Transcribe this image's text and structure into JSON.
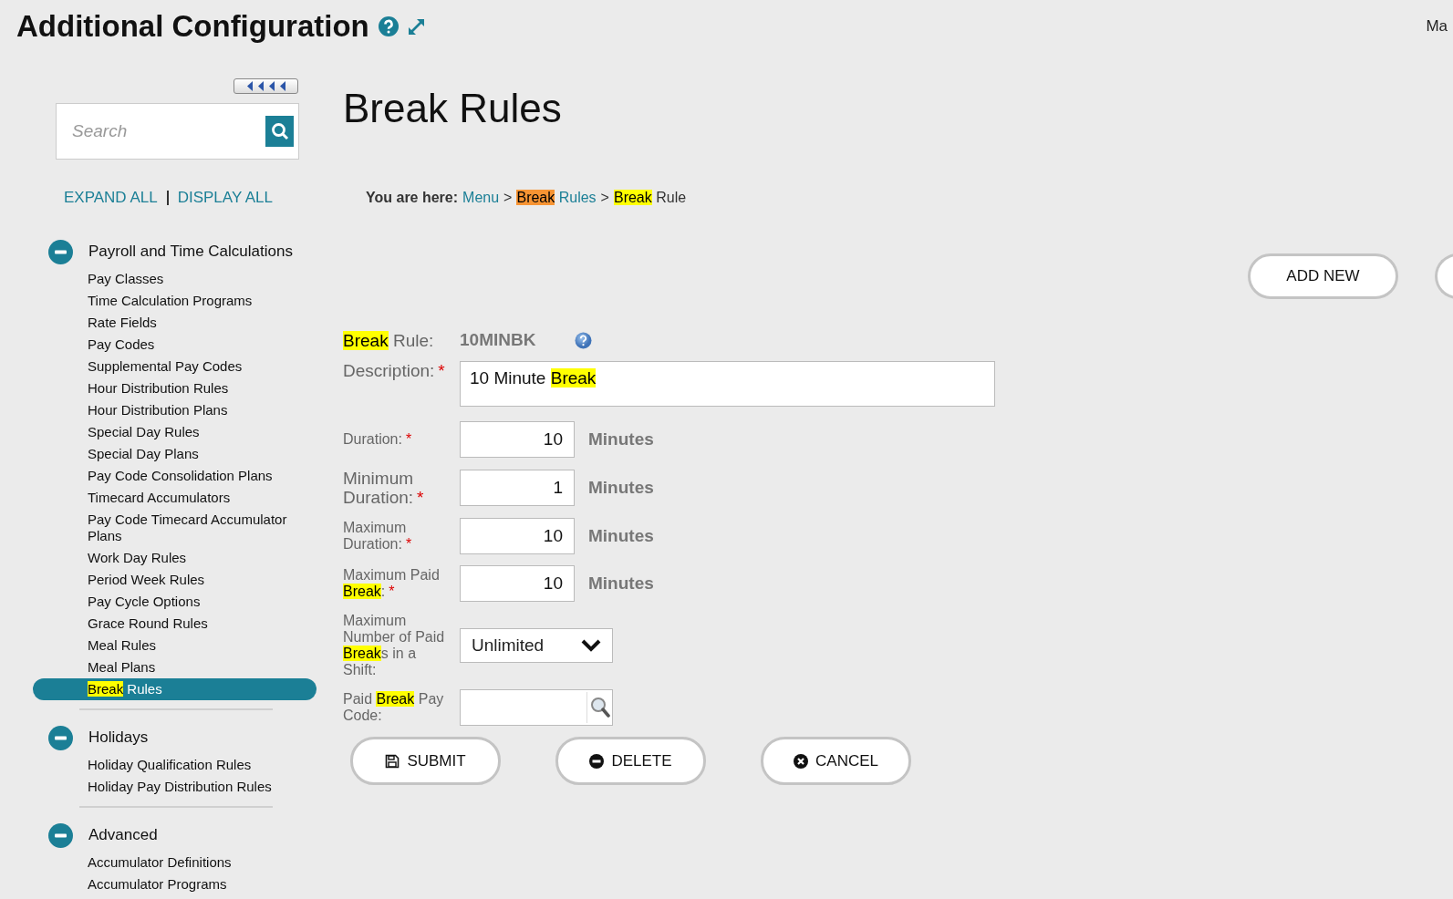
{
  "header": {
    "title": "Additional Configuration",
    "corner_text": "Ma"
  },
  "sidebar": {
    "search": {
      "placeholder": "Search"
    },
    "links": [
      "EXPAND ALL",
      "DISPLAY ALL"
    ],
    "groups": [
      {
        "title": "Payroll and Time Calculations",
        "expanded": true,
        "items": [
          {
            "parts": [
              {
                "text": "Pay Classes"
              }
            ],
            "selected": false
          },
          {
            "parts": [
              {
                "text": "Time Calculation Programs"
              }
            ],
            "selected": false
          },
          {
            "parts": [
              {
                "text": "Rate Fields"
              }
            ],
            "selected": false
          },
          {
            "parts": [
              {
                "text": "Pay Codes"
              }
            ],
            "selected": false
          },
          {
            "parts": [
              {
                "text": "Supplemental Pay Codes"
              }
            ],
            "selected": false
          },
          {
            "parts": [
              {
                "text": "Hour Distribution Rules"
              }
            ],
            "selected": false
          },
          {
            "parts": [
              {
                "text": "Hour Distribution Plans"
              }
            ],
            "selected": false
          },
          {
            "parts": [
              {
                "text": "Special Day Rules"
              }
            ],
            "selected": false
          },
          {
            "parts": [
              {
                "text": "Special Day Plans"
              }
            ],
            "selected": false
          },
          {
            "parts": [
              {
                "text": "Pay Code Consolidation Plans"
              }
            ],
            "selected": false
          },
          {
            "parts": [
              {
                "text": "Timecard Accumulators"
              }
            ],
            "selected": false
          },
          {
            "parts": [
              {
                "text": "Pay Code Timecard Accumulator Plans"
              }
            ],
            "selected": false
          },
          {
            "parts": [
              {
                "text": "Work Day Rules"
              }
            ],
            "selected": false
          },
          {
            "parts": [
              {
                "text": "Period Week Rules"
              }
            ],
            "selected": false
          },
          {
            "parts": [
              {
                "text": "Pay Cycle Options"
              }
            ],
            "selected": false
          },
          {
            "parts": [
              {
                "text": "Grace Round Rules"
              }
            ],
            "selected": false
          },
          {
            "parts": [
              {
                "text": "Meal Rules"
              }
            ],
            "selected": false
          },
          {
            "parts": [
              {
                "text": "Meal Plans"
              }
            ],
            "selected": false
          },
          {
            "parts": [
              {
                "text": "Break",
                "highlighted": true,
                "color": "#ffff00"
              },
              {
                "text": " Rules"
              }
            ],
            "selected": true
          }
        ]
      },
      {
        "title": "Holidays",
        "expanded": true,
        "items": [
          {
            "parts": [
              {
                "text": "Holiday Qualification Rules"
              }
            ],
            "selected": false
          },
          {
            "parts": [
              {
                "text": "Holiday Pay Distribution Rules"
              }
            ],
            "selected": false
          }
        ]
      },
      {
        "title": "Advanced",
        "expanded": true,
        "items": [
          {
            "parts": [
              {
                "text": "Accumulator Definitions"
              }
            ],
            "selected": false
          },
          {
            "parts": [
              {
                "text": "Accumulator Programs"
              }
            ],
            "selected": false
          }
        ]
      }
    ]
  },
  "main": {
    "title": "Break Rules",
    "breadcrumb": {
      "prefix": "You are here:",
      "separator": ">",
      "crumbs": [
        {
          "parts": [
            {
              "text": "Menu"
            }
          ],
          "link": true
        },
        {
          "parts": [
            {
              "text": "Break",
              "highlighted": true,
              "color": "#f79433"
            },
            {
              "text": " Rules"
            }
          ],
          "link": true
        },
        {
          "parts": [
            {
              "text": "Break",
              "highlighted": true,
              "color": "#ffff00"
            },
            {
              "text": " Rule"
            }
          ],
          "link": false
        }
      ]
    },
    "toolbar": [
      {
        "kind": "button",
        "label": "ADD NEW"
      },
      {
        "kind": "partial"
      }
    ],
    "fields": [
      {
        "kind": "readonly",
        "label": [
          {
            "text": "Break",
            "highlighted": true,
            "color": "#ffff00"
          },
          {
            "text": " Rule:"
          }
        ],
        "value": "10MINBK"
      },
      {
        "kind": "text",
        "label": [
          {
            "text": "Description:"
          }
        ],
        "required_mark": "*",
        "value": [
          {
            "text": "10 Minute "
          },
          {
            "text": "Break",
            "highlighted": true,
            "color": "#ffff00"
          }
        ]
      },
      {
        "kind": "number",
        "label": [
          {
            "text": "Duration:"
          }
        ],
        "required_mark": "*",
        "value": "10",
        "unit": "Minutes"
      },
      {
        "kind": "number",
        "label": [
          {
            "text": "Minimum Duration:"
          }
        ],
        "required_mark": "*",
        "value": "1",
        "unit": "Minutes"
      },
      {
        "kind": "number",
        "label": [
          {
            "text": "Maximum Duration:"
          }
        ],
        "required_mark": "*",
        "value": "10",
        "unit": "Minutes"
      },
      {
        "kind": "number",
        "label": [
          {
            "text": "Maximum Paid "
          },
          {
            "text": "Break",
            "highlighted": true,
            "color": "#ffff00"
          },
          {
            "text": ":"
          }
        ],
        "required_mark": "*",
        "value": "10",
        "unit": "Minutes"
      },
      {
        "kind": "select",
        "label": [
          {
            "text": "Maximum Number of Paid "
          },
          {
            "text": "Break",
            "highlighted": true,
            "color": "#ffff00"
          },
          {
            "text": "s in a Shift:"
          }
        ],
        "value": "Unlimited"
      },
      {
        "kind": "lookup",
        "label": [
          {
            "text": "Paid "
          },
          {
            "text": "Break",
            "highlighted": true,
            "color": "#ffff00"
          },
          {
            "text": " Pay Code:"
          }
        ]
      }
    ],
    "actions": [
      {
        "label": "SUBMIT",
        "kind": "save"
      },
      {
        "label": "DELETE",
        "kind": "delete"
      },
      {
        "label": "CANCEL",
        "kind": "cancel"
      }
    ]
  }
}
